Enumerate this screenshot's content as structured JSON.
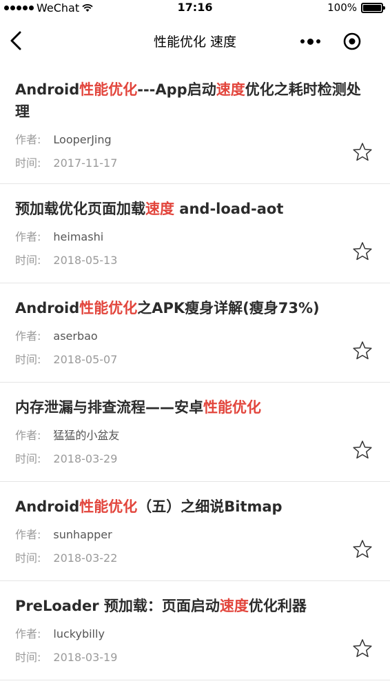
{
  "status_bar": {
    "carrier": "WeChat",
    "time": "17:16",
    "battery": "100%"
  },
  "nav": {
    "title": "性能优化 速度"
  },
  "labels": {
    "author": "作者:",
    "time": "时间:"
  },
  "articles": [
    {
      "title_parts": [
        {
          "text": "Android",
          "highlight": false
        },
        {
          "text": "性能优化",
          "highlight": true
        },
        {
          "text": "---App启动",
          "highlight": false
        },
        {
          "text": "速度",
          "highlight": true
        },
        {
          "text": "优化之耗时检测处理",
          "highlight": false
        }
      ],
      "author": "LooperJing",
      "date": "2017-11-17"
    },
    {
      "title_parts": [
        {
          "text": "预加载优化页面加载",
          "highlight": false
        },
        {
          "text": "速度",
          "highlight": true
        },
        {
          "text": " and-load-aot",
          "highlight": false
        }
      ],
      "author": "heimashi",
      "date": "2018-05-13"
    },
    {
      "title_parts": [
        {
          "text": "Android",
          "highlight": false
        },
        {
          "text": "性能优化",
          "highlight": true
        },
        {
          "text": "之APK瘦身详解(瘦身73%)",
          "highlight": false
        }
      ],
      "author": "aserbao",
      "date": "2018-05-07"
    },
    {
      "title_parts": [
        {
          "text": "内存泄漏与排查流程——安卓",
          "highlight": false
        },
        {
          "text": "性能优化",
          "highlight": true
        }
      ],
      "author": "猛猛的小盆友",
      "date": "2018-03-29"
    },
    {
      "title_parts": [
        {
          "text": "Android",
          "highlight": false
        },
        {
          "text": "性能优化",
          "highlight": true
        },
        {
          "text": "（五）之细说Bitmap",
          "highlight": false
        }
      ],
      "author": "sunhapper",
      "date": "2018-03-22"
    },
    {
      "title_parts": [
        {
          "text": "PreLoader 预加载：页面启动",
          "highlight": false
        },
        {
          "text": "速度",
          "highlight": true
        },
        {
          "text": "优化利器",
          "highlight": false
        }
      ],
      "author": "luckybilly",
      "date": "2018-03-19"
    }
  ],
  "colors": {
    "highlight": "#e2453c",
    "title": "#2b2b2b",
    "meta_label": "#9a9a9a",
    "divider": "#e5e5e5"
  },
  "icons": {
    "back": "chevron-left-icon",
    "more": "more-dots-icon",
    "close": "target-circle-icon",
    "favorite": "star-outline-icon",
    "wifi": "wifi-icon",
    "battery": "battery-icon"
  }
}
